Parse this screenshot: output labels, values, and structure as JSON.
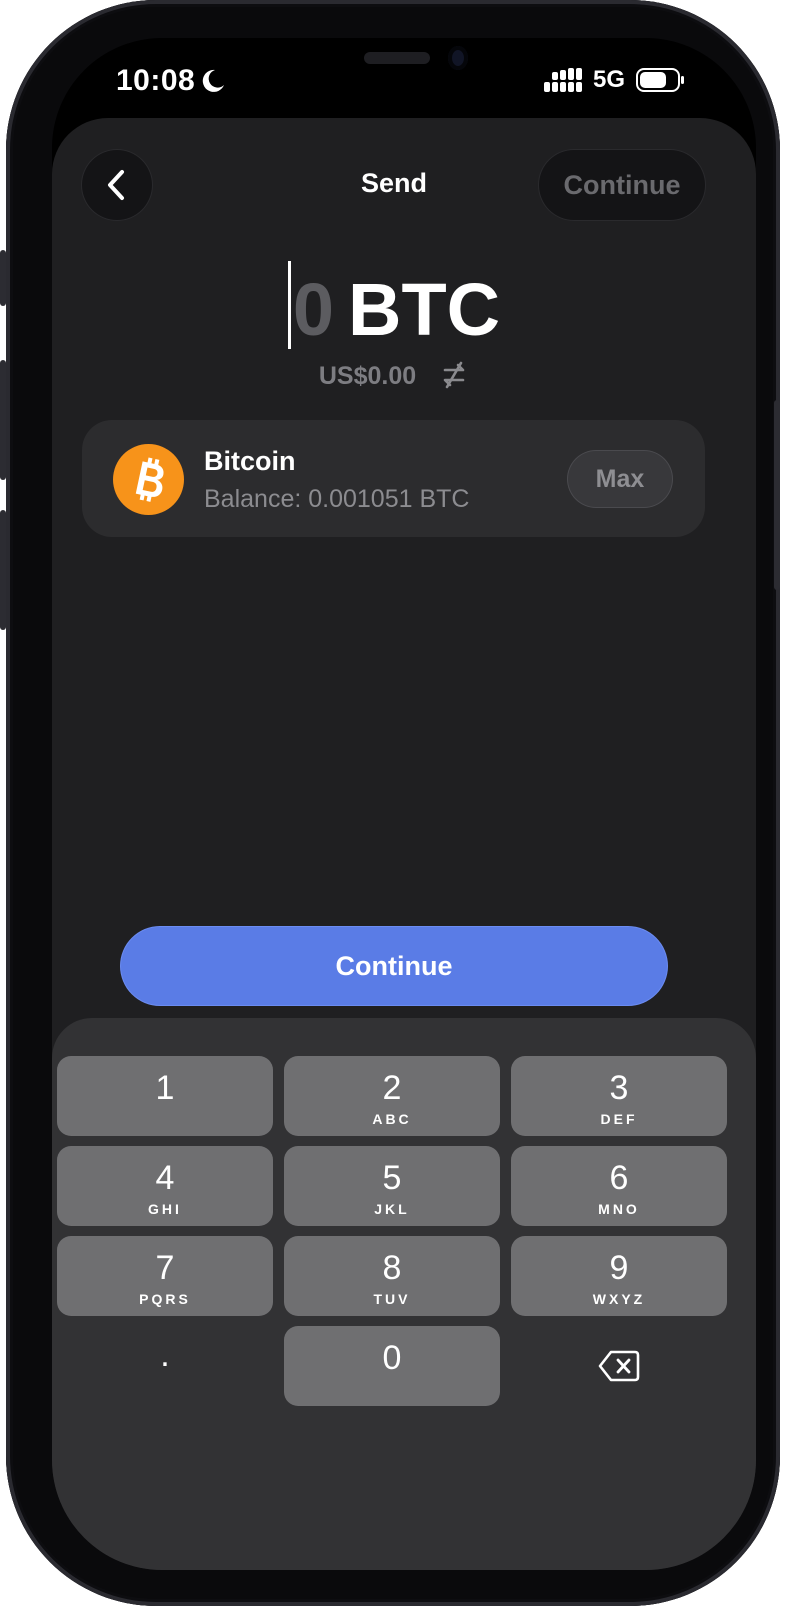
{
  "status_bar": {
    "time": "10:08",
    "network": "5G",
    "icons": [
      "moon-icon",
      "signal-icon",
      "battery-icon"
    ]
  },
  "header": {
    "title": "Send",
    "back_icon": "chevron-left-icon",
    "continue_label": "Continue"
  },
  "amount": {
    "value": "0",
    "unit": "BTC",
    "fiat": "US$0.00",
    "swap_icon": "swap-icon"
  },
  "asset": {
    "name": "Bitcoin",
    "balance": "Balance: 0.001051 BTC",
    "max_label": "Max",
    "icon": "bitcoin-icon"
  },
  "actions": {
    "continue_label": "Continue"
  },
  "keypad": {
    "keys": [
      {
        "digit": "1",
        "letters": ""
      },
      {
        "digit": "2",
        "letters": "ABC"
      },
      {
        "digit": "3",
        "letters": "DEF"
      },
      {
        "digit": "4",
        "letters": "GHI"
      },
      {
        "digit": "5",
        "letters": "JKL"
      },
      {
        "digit": "6",
        "letters": "MNO"
      },
      {
        "digit": "7",
        "letters": "PQRS"
      },
      {
        "digit": "8",
        "letters": "TUV"
      },
      {
        "digit": "9",
        "letters": "WXYZ"
      },
      {
        "digit": ".",
        "letters": ""
      },
      {
        "digit": "0",
        "letters": ""
      }
    ],
    "backspace_icon": "backspace-icon"
  },
  "colors": {
    "accent": "#5a7ce6",
    "bitcoin": "#f7931a",
    "background": "#1f1f21",
    "keypad": "#323234",
    "key": "#6f6f71"
  }
}
